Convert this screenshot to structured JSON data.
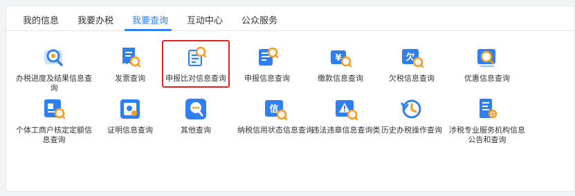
{
  "tabs": [
    {
      "label": "我的信息"
    },
    {
      "label": "我要办税"
    },
    {
      "label": "我要查询",
      "active": true
    },
    {
      "label": "互动中心"
    },
    {
      "label": "公众服务"
    }
  ],
  "accent_color": "#2f7ff0",
  "highlight_color": "#e51f1f",
  "items": [
    {
      "label": "办税进度及结果信息查询",
      "icon": "progress-search-icon"
    },
    {
      "label": "发票查询",
      "icon": "invoice-search-icon"
    },
    {
      "label": "申报比对信息查询",
      "icon": "declaration-compare-icon",
      "highlighted": true
    },
    {
      "label": "申报信息查询",
      "icon": "declaration-search-icon"
    },
    {
      "label": "缴款信息查询",
      "icon": "payment-search-icon"
    },
    {
      "label": "欠税信息查询",
      "icon": "arrears-search-icon"
    },
    {
      "label": "优惠信息查询",
      "icon": "preferential-search-icon"
    },
    {
      "label": "个体工商户核定定额信息查询",
      "icon": "business-quota-icon"
    },
    {
      "label": "证明信息查询",
      "icon": "certificate-search-icon"
    },
    {
      "label": "其他查询",
      "icon": "other-search-icon"
    },
    {
      "label": "纳税信用状态信息查询",
      "icon": "credit-status-icon"
    },
    {
      "label": "违法违章信息查询类",
      "icon": "violation-search-icon"
    },
    {
      "label": "历史办税操作查询",
      "icon": "history-icon"
    },
    {
      "label": "涉税专业服务机构信息公告和查询",
      "icon": "agency-search-icon"
    }
  ],
  "icon_texts": {
    "payment": "¥",
    "arrears": "欠",
    "credit": "信"
  }
}
